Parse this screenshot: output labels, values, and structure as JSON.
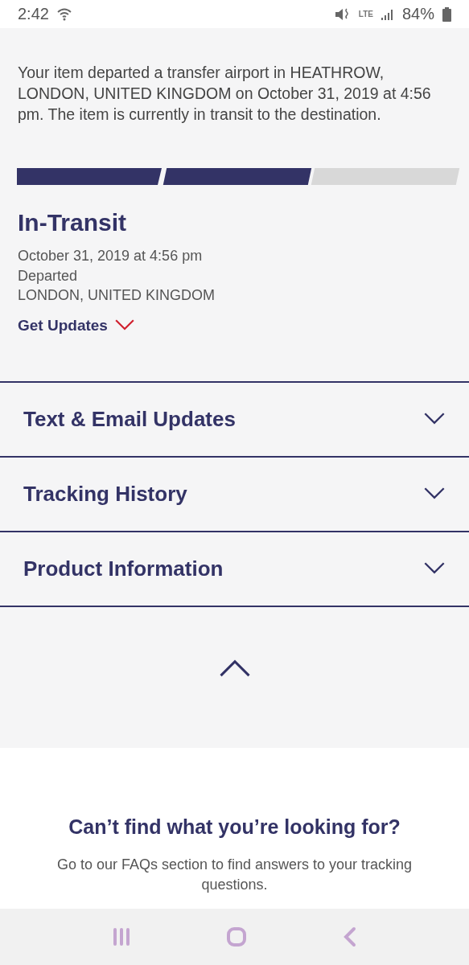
{
  "status_bar": {
    "time": "2:42",
    "network": "LTE",
    "battery": "84%"
  },
  "summary": "Your item departed a transfer airport in HEATHROW, LONDON, UNITED KINGDOM on October 31, 2019 at 4:56 pm. The item is currently in transit to the destination.",
  "progress": [
    {
      "filled": true
    },
    {
      "filled": true
    },
    {
      "filled": false
    }
  ],
  "status": {
    "title": "In-Transit",
    "datetime": "October 31, 2019 at 4:56 pm",
    "event": "Departed",
    "location": "LONDON, UNITED KINGDOM",
    "link": "Get Updates"
  },
  "sections": [
    {
      "title": "Text & Email Updates",
      "expanded": false
    },
    {
      "title": "Tracking History",
      "expanded": false
    },
    {
      "title": "Product Information",
      "expanded": false
    }
  ],
  "help": {
    "heading": "Can’t find what you’re looking for?",
    "text": "Go to our FAQs section to find answers to your tracking questions."
  }
}
